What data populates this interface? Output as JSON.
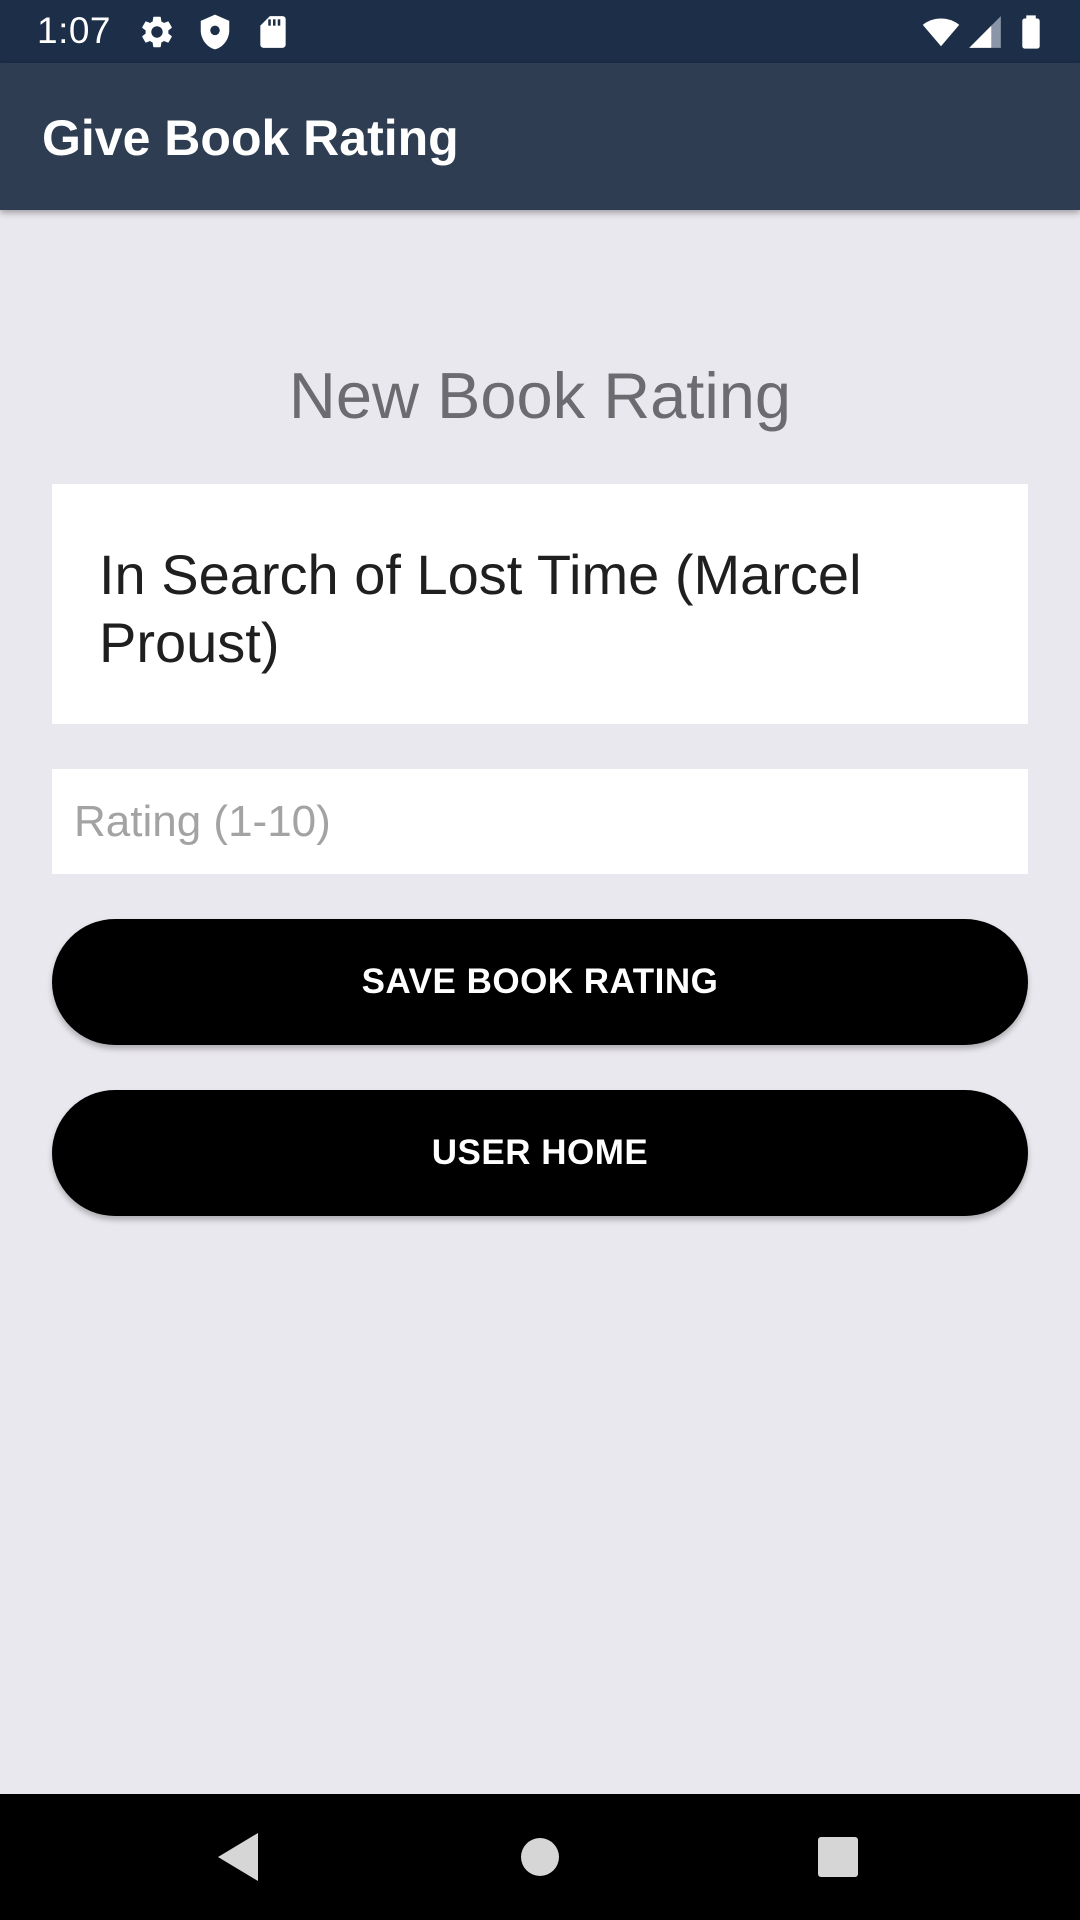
{
  "status_bar": {
    "time": "1:07",
    "icons": [
      "gear-icon",
      "shield-icon",
      "sd-card-icon",
      "wifi-icon",
      "signal-icon",
      "battery-icon"
    ]
  },
  "app_bar": {
    "title": "Give Book Rating"
  },
  "main": {
    "heading": "New Book Rating",
    "book_title": "In Search of Lost Time (Marcel Proust)",
    "rating_input": {
      "value": "",
      "placeholder": "Rating (1-10)"
    },
    "save_button_label": "SAVE BOOK RATING",
    "home_button_label": "USER HOME"
  },
  "nav_bar": {
    "icons": [
      "back-icon",
      "home-icon",
      "recents-icon"
    ]
  },
  "colors": {
    "status_bar_bg": "#1c2e48",
    "app_bar_bg": "#2e3d52",
    "page_bg": "#e9e8ee",
    "button_bg": "#000000",
    "button_text": "#ffffff"
  }
}
